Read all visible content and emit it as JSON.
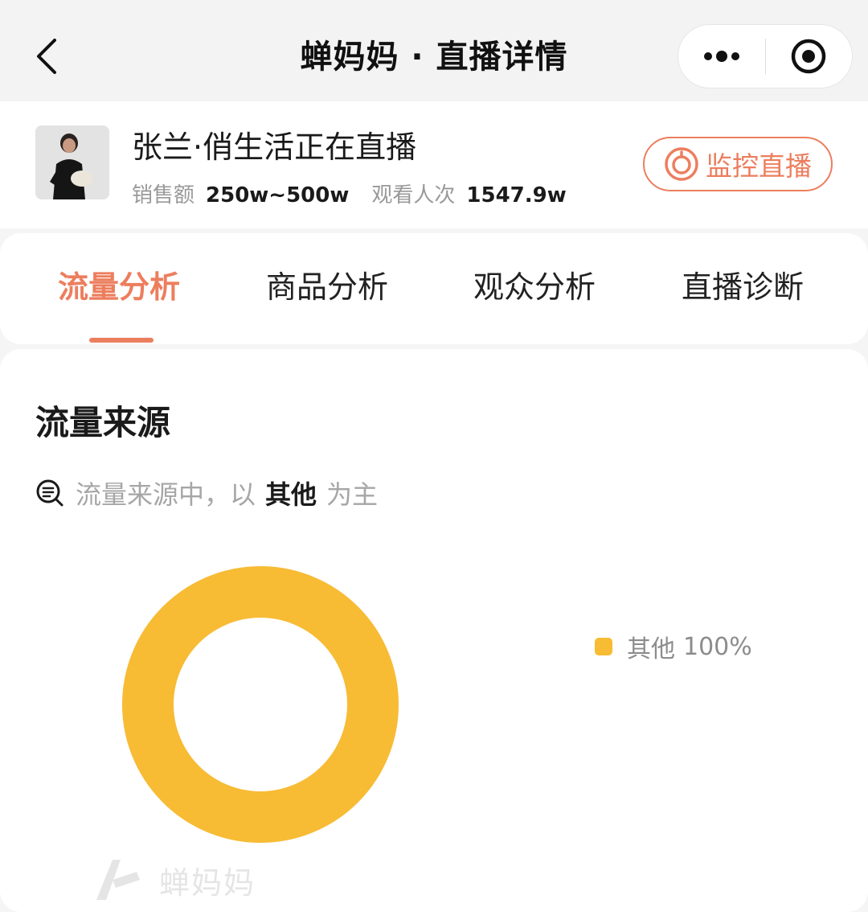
{
  "header": {
    "title": "蝉妈妈 · 直播详情",
    "back_icon": "chevron-left-icon",
    "more_icon": "more-dots-icon",
    "close_icon": "target-close-icon"
  },
  "streamer": {
    "name": "张兰·俏生活正在直播",
    "stats": [
      {
        "label": "销售额",
        "value": "250w~500w"
      },
      {
        "label": "观看人次",
        "value": "1547.9w"
      }
    ],
    "monitor_button": "监控直播"
  },
  "tabs": [
    {
      "label": "流量分析",
      "active": true
    },
    {
      "label": "商品分析",
      "active": false
    },
    {
      "label": "观众分析",
      "active": false
    },
    {
      "label": "直播诊断",
      "active": false
    }
  ],
  "traffic": {
    "title": "流量来源",
    "insight_prefix": "流量来源中，以",
    "insight_highlight": "其他",
    "insight_suffix": "为主",
    "watermark": "蝉妈妈"
  },
  "colors": {
    "accent": "#ec7e5e",
    "donut": "#f7bb34"
  },
  "chart_data": {
    "type": "pie",
    "donut": true,
    "categories": [
      "其他"
    ],
    "values": [
      100
    ],
    "labels": [
      "100%"
    ],
    "legend_position": "right"
  }
}
